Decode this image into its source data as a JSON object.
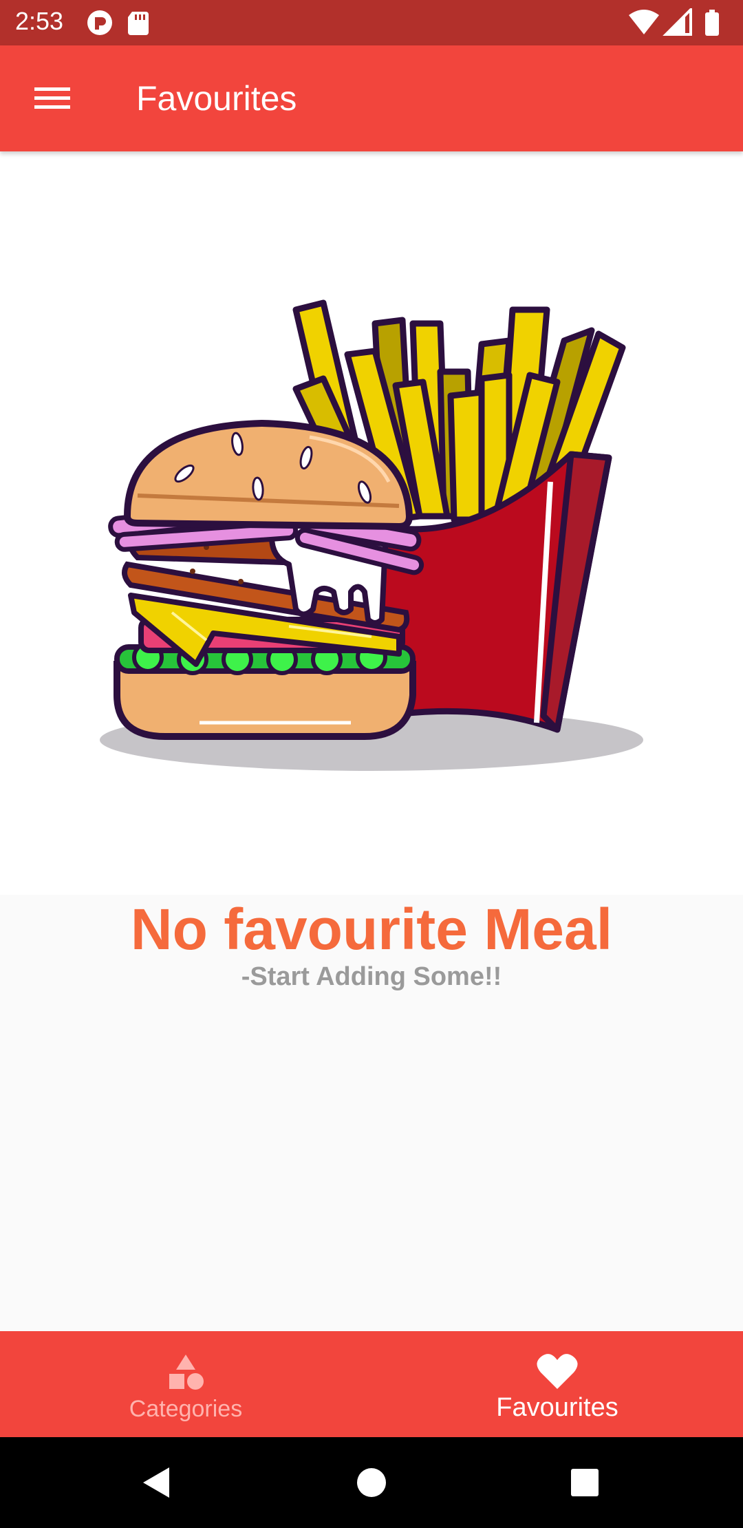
{
  "status_bar": {
    "time": "2:53",
    "left_icons": [
      "notification-icon",
      "sd-card-icon"
    ],
    "right_icons": [
      "wifi-icon",
      "signal-icon",
      "battery-icon"
    ]
  },
  "app_bar": {
    "menu_icon": "menu-icon",
    "title": "Favourites",
    "color": "#f2453d"
  },
  "empty_state": {
    "title": "No favourite Meal",
    "subtitle": "-Start Adding Some!!",
    "title_color": "#f56a3c",
    "subtitle_color": "#9a9a9a",
    "illustration": "burger-and-fries-illustration"
  },
  "bottom_nav": {
    "items": [
      {
        "label": "Categories",
        "icon": "categories-icon",
        "active": false
      },
      {
        "label": "Favourites",
        "icon": "heart-icon",
        "active": true
      }
    ]
  },
  "system_nav": {
    "buttons": [
      "back-icon",
      "home-icon",
      "recents-icon"
    ]
  }
}
